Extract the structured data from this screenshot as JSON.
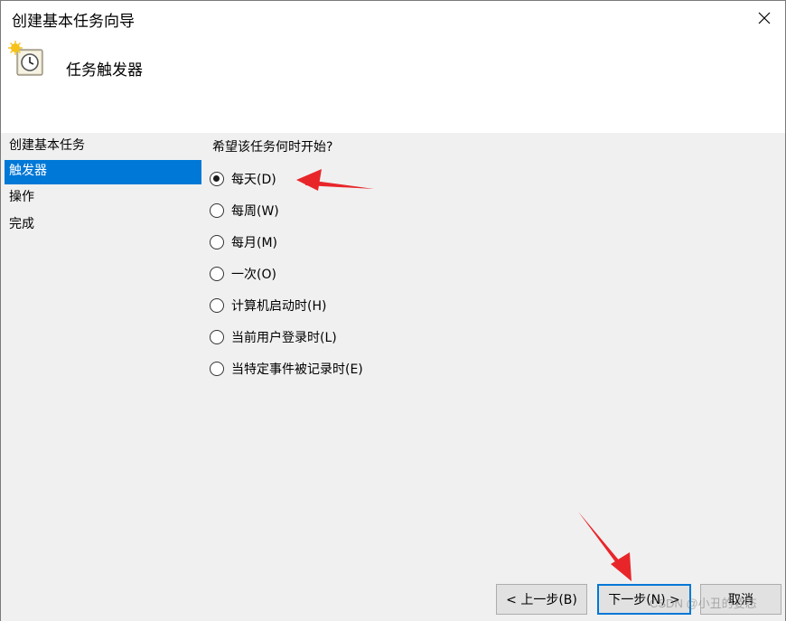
{
  "window": {
    "title": "创建基本任务向导"
  },
  "header": {
    "title": "任务触发器"
  },
  "nav": {
    "items": [
      {
        "label": "创建基本任务"
      },
      {
        "label": "触发器"
      },
      {
        "label": "操作"
      },
      {
        "label": "完成"
      }
    ]
  },
  "main": {
    "question": "希望该任务何时开始?",
    "options": [
      {
        "label": "每天(D)",
        "checked": true
      },
      {
        "label": "每周(W)",
        "checked": false
      },
      {
        "label": "每月(M)",
        "checked": false
      },
      {
        "label": "一次(O)",
        "checked": false
      },
      {
        "label": "计算机启动时(H)",
        "checked": false
      },
      {
        "label": "当前用户登录时(L)",
        "checked": false
      },
      {
        "label": "当特定事件被记录时(E)",
        "checked": false
      }
    ]
  },
  "footer": {
    "back_label": "< 上一步(B)",
    "next_label": "下一步(N) >",
    "cancel_label": "取消"
  },
  "watermark": "CSDN @小丑的姿态",
  "colors": {
    "selection": "#0078d7",
    "annotation_arrow": "#e8262a"
  },
  "icons": [
    "close-icon",
    "task-clock-icon"
  ]
}
